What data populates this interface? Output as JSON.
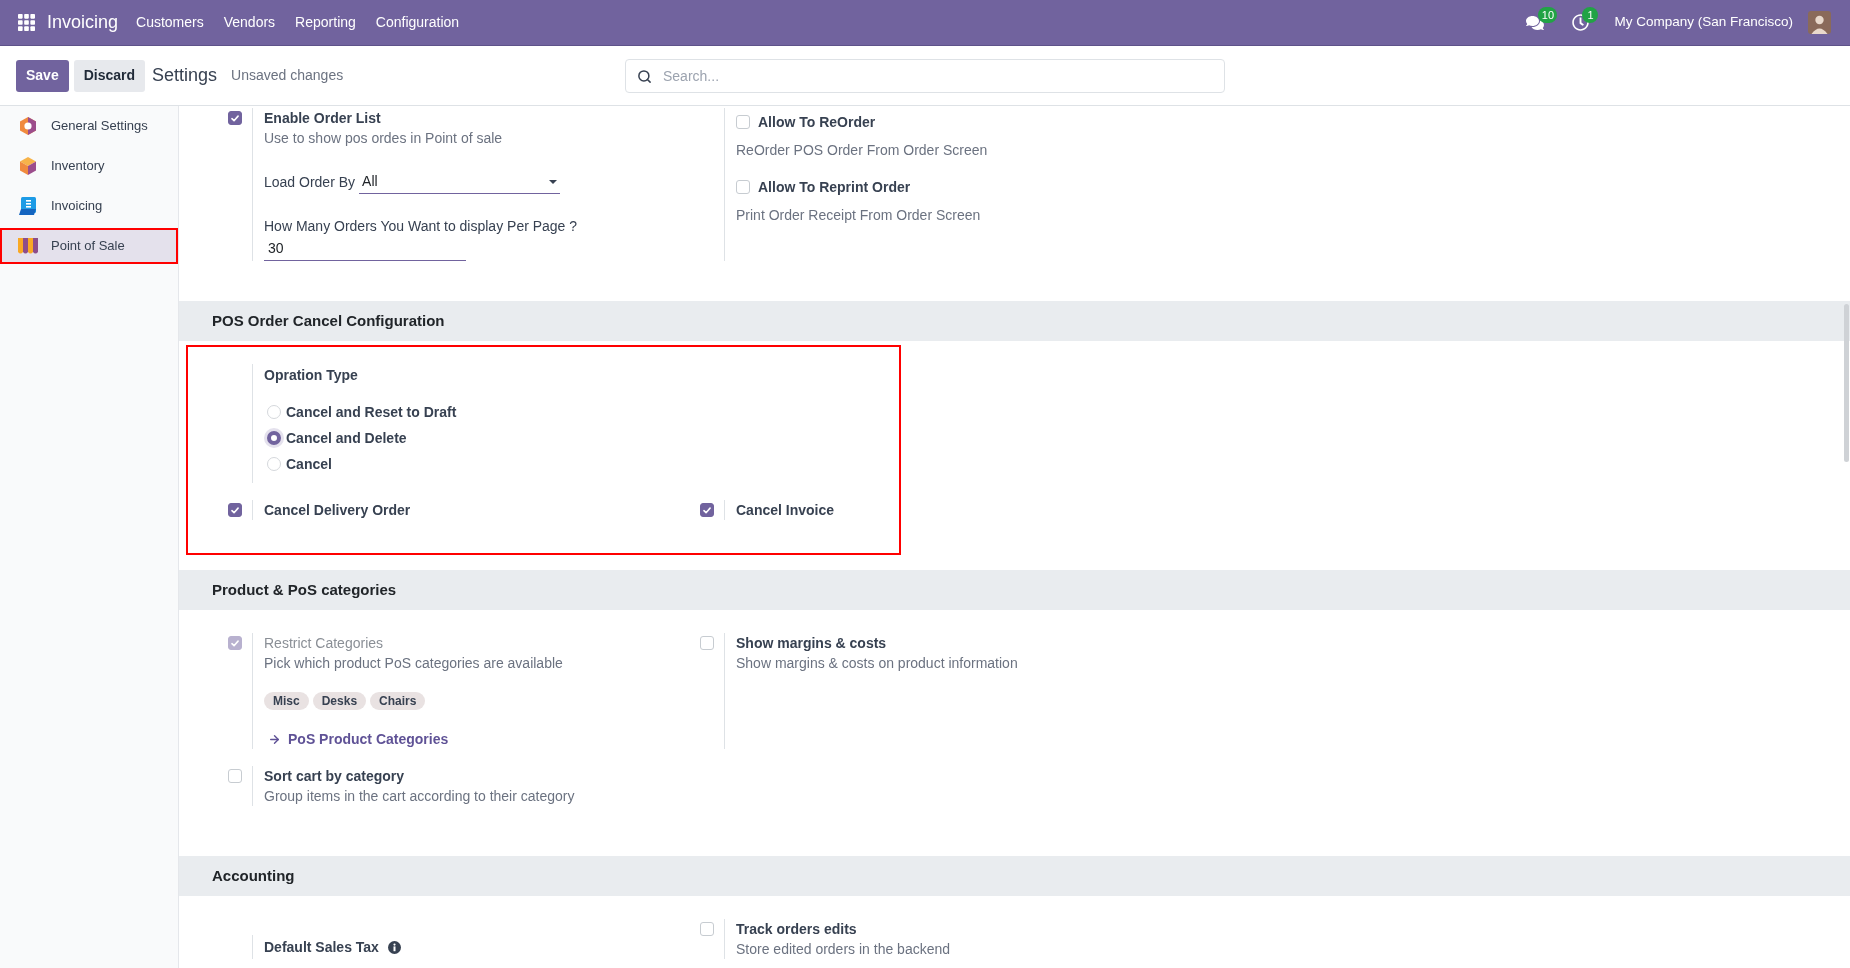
{
  "top_bar": {
    "app_name": "Invoicing",
    "menu": [
      "Customers",
      "Vendors",
      "Reporting",
      "Configuration"
    ],
    "messages_count": "10",
    "activities_count": "1",
    "company": "My Company (San Francisco)"
  },
  "control_panel": {
    "buttons": [
      {
        "label": "Save",
        "kind": "primary"
      },
      {
        "label": "Discard",
        "kind": "secondary"
      }
    ],
    "breadcrumb": "Settings",
    "status": "Unsaved changes",
    "search": {
      "placeholder": "Search..."
    }
  },
  "sidebar": {
    "items": [
      {
        "label": "General Settings",
        "selected": false,
        "highlighted": false
      },
      {
        "label": "Inventory",
        "selected": false,
        "highlighted": false
      },
      {
        "label": "Invoicing",
        "selected": false,
        "highlighted": false
      },
      {
        "label": "Point of Sale",
        "selected": true,
        "highlighted": true
      }
    ]
  },
  "sections": [
    {
      "cells": [
        {
          "kind": "checkbox",
          "label": "Enable Order List",
          "checked": true,
          "disabled": false,
          "description": "Use to show pos ordes in Point of sale",
          "fields": [
            {
              "kind": "select",
              "label": "Load Order By",
              "value": "All"
            },
            {
              "kind": "input",
              "label": "How Many Orders You Want to display Per Page ?",
              "value": "30"
            }
          ]
        },
        {
          "kind": "options",
          "items": [
            {
              "label": "Allow To ReOrder",
              "checked": false,
              "description": "ReOrder POS Order From Order Screen"
            },
            {
              "label": "Allow To Reprint Order",
              "checked": false,
              "description": "Print Order Receipt From Order Screen"
            }
          ]
        }
      ]
    },
    {
      "title": "POS Order Cancel Configuration",
      "highlighted": true,
      "cells": [
        {
          "kind": "radio",
          "label": "Opration Type",
          "options": [
            {
              "label": "Cancel and Reset to Draft",
              "selected": false
            },
            {
              "label": "Cancel and Delete",
              "selected": true
            },
            {
              "label": "Cancel",
              "selected": false
            }
          ]
        },
        {
          "kind": "checkbox",
          "label": "Cancel Delivery Order",
          "checked": true,
          "disabled": false
        },
        {
          "kind": "checkbox",
          "label": "Cancel Invoice",
          "checked": true,
          "disabled": false
        }
      ]
    },
    {
      "title": "Product & PoS categories",
      "highlighted": false,
      "cells": [
        {
          "kind": "checkbox",
          "label": "Restrict Categories",
          "checked": true,
          "disabled": true,
          "description": "Pick which product PoS categories are available",
          "tags": [
            "Misc",
            "Desks",
            "Chairs"
          ],
          "link": "PoS Product Categories"
        },
        {
          "kind": "checkbox",
          "label": "Show margins & costs",
          "checked": false,
          "disabled": false,
          "description": "Show margins & costs on product information"
        },
        {
          "kind": "checkbox",
          "label": "Sort cart by category",
          "checked": false,
          "disabled": false,
          "description": "Group items in the cart according to their category"
        }
      ]
    },
    {
      "title": "Accounting",
      "highlighted": false,
      "cells": [
        {
          "kind": "plain",
          "label": "Default Sales Tax",
          "help": true
        },
        {
          "kind": "checkbox",
          "label": "Track orders edits",
          "checked": false,
          "disabled": false,
          "description": "Store edited orders in the backend"
        }
      ]
    }
  ]
}
